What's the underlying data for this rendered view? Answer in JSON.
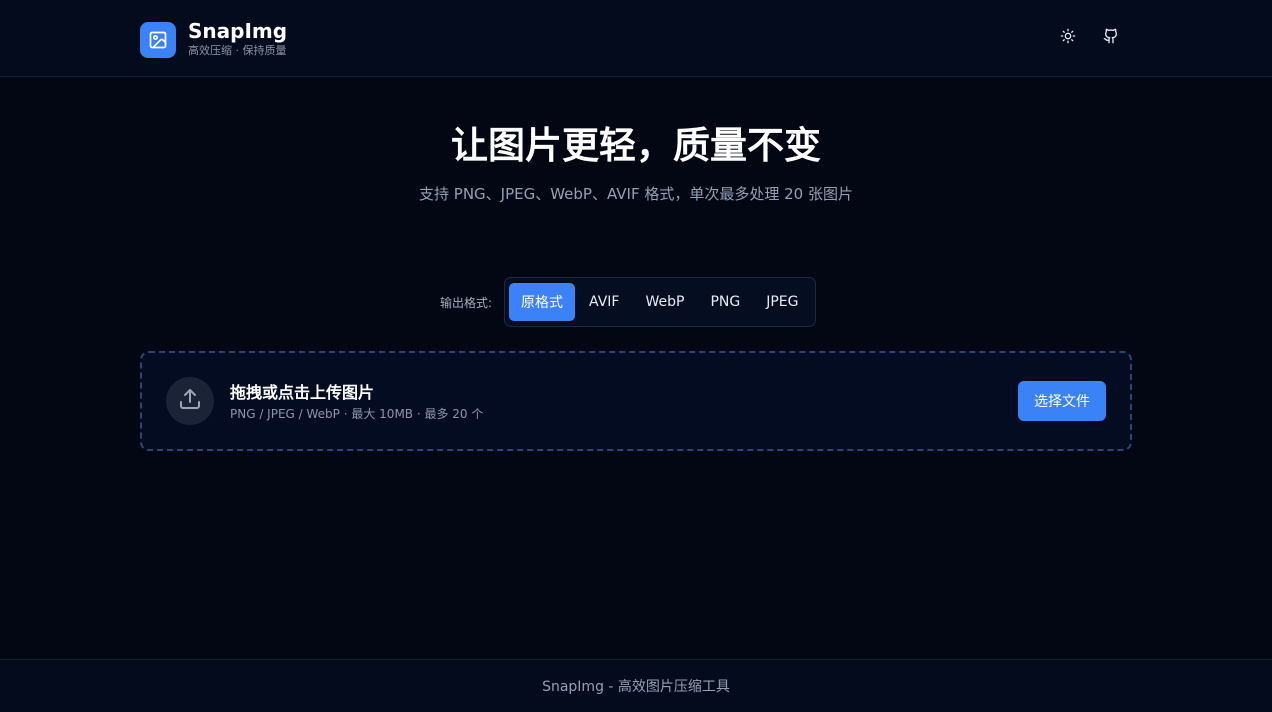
{
  "app": {
    "name": "SnapImg",
    "tagline": "高效压缩 · 保持质量"
  },
  "header": {
    "icons": [
      "sun-icon",
      "github-icon"
    ]
  },
  "hero": {
    "title": "让图片更轻，质量不变",
    "subtitle": "支持 PNG、JPEG、WebP、AVIF 格式，单次最多处理 20 张图片"
  },
  "format": {
    "label": "输出格式:",
    "options": [
      "原格式",
      "AVIF",
      "WebP",
      "PNG",
      "JPEG"
    ],
    "selected": "原格式"
  },
  "upload": {
    "title": "拖拽或点击上传图片",
    "hint": "PNG / JPEG / WebP · 最大 10MB · 最多 20 个",
    "button_label": "选择文件"
  },
  "footer": {
    "text": "SnapImg - 高效图片压缩工具"
  },
  "colors": {
    "accent": "#3b82f6",
    "background": "#020713",
    "surface": "#040b1d"
  }
}
